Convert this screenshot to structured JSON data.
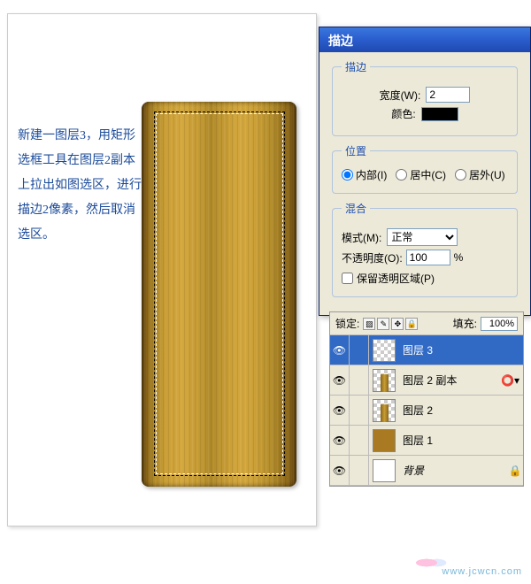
{
  "instruction": "新建一图层3，用矩形选框工具在图层2副本上拉出如图选区，进行描边2像素，然后取消选区。",
  "dialog": {
    "title": "描边",
    "stroke": {
      "legend": "描边",
      "width_label": "宽度(W):",
      "width_value": "2",
      "color_label": "颜色:"
    },
    "position": {
      "legend": "位置",
      "opts": [
        "内部(I)",
        "居中(C)",
        "居外(U)"
      ],
      "selected": 0
    },
    "blend": {
      "legend": "混合",
      "mode_label": "模式(M):",
      "mode_value": "正常",
      "opacity_label": "不透明度(O):",
      "opacity_value": "100",
      "opacity_suffix": "%",
      "preserve_label": "保留透明区域(P)"
    }
  },
  "layers_panel": {
    "lock_label": "锁定:",
    "fill_label": "填充:",
    "fill_value": "100%",
    "layers": [
      {
        "name": "图层 3",
        "active": true,
        "thumb": "trans"
      },
      {
        "name": "图层 2 副本",
        "thumb": "wood",
        "fx": true
      },
      {
        "name": "图层 2",
        "thumb": "wood"
      },
      {
        "name": "图层 1",
        "thumb": "solid"
      },
      {
        "name": "背景",
        "thumb": "white",
        "italic": true,
        "locked": true
      }
    ]
  },
  "watermark": "www.jcwcn.com"
}
